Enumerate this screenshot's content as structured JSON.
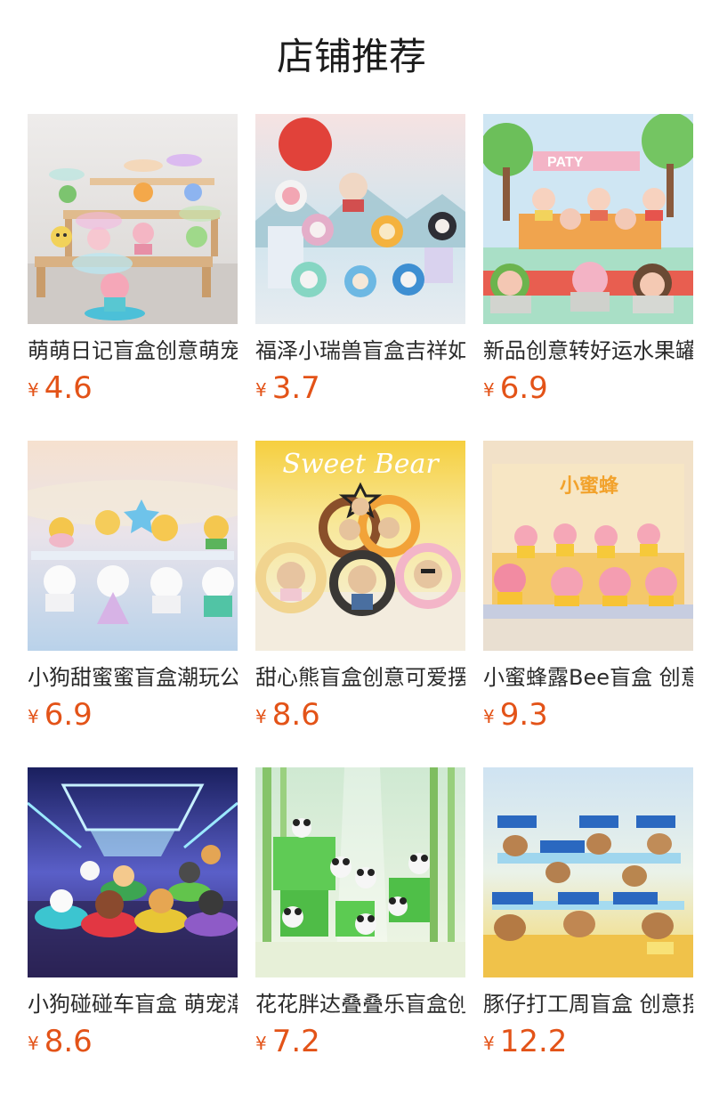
{
  "header": {
    "title": "店铺推荐"
  },
  "products": [
    {
      "name": "萌萌日记盲盒创意萌宠",
      "currency": "¥",
      "price": "4.6",
      "image": "umbrella-animal-figures-on-wooden-shelf"
    },
    {
      "name": "福泽小瑞兽盲盒吉祥如意",
      "currency": "¥",
      "price": "3.7",
      "image": "lion-dance-figures-with-red-sun"
    },
    {
      "name": "新品创意转好运水果罐头",
      "currency": "¥",
      "price": "6.9",
      "image": "fruit-can-dolls-party-stage"
    },
    {
      "name": "小狗甜蜜蜜盲盒潮玩公仔",
      "currency": "¥",
      "price": "6.9",
      "image": "puppy-and-bear-figures-snowy"
    },
    {
      "name": "甜心熊盲盒创意可爱摆件",
      "currency": "¥",
      "price": "8.6",
      "image": "sweet-bear-donut-figures"
    },
    {
      "name": "小蜜蜂露Bee盲盒 创意",
      "currency": "¥",
      "price": "9.3",
      "image": "bee-costume-figures-on-boxes"
    },
    {
      "name": "小狗碰碰车盲盒 萌宠潮玩",
      "currency": "¥",
      "price": "8.6",
      "image": "dogs-in-bumper-cars"
    },
    {
      "name": "花花胖达叠叠乐盲盒创意",
      "currency": "¥",
      "price": "7.2",
      "image": "panda-figures-bamboo-forest"
    },
    {
      "name": "豚仔打工周盲盒 创意摆件",
      "currency": "¥",
      "price": "12.2",
      "image": "capybara-workers-on-stand"
    }
  ],
  "image_texts": {
    "fruit_sign": "PATY",
    "sweet_bear": "Sweet Bear",
    "bee_box": "小蜜蜂"
  }
}
